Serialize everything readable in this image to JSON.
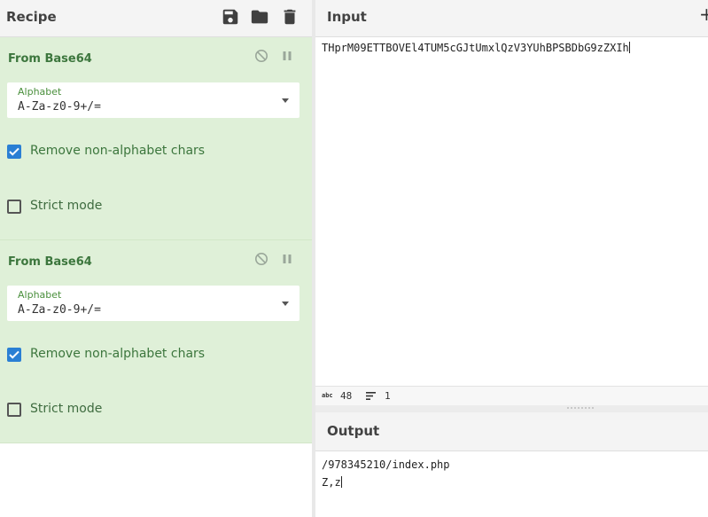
{
  "recipe": {
    "title": "Recipe",
    "icons": [
      "save-icon",
      "folder-icon",
      "trash-icon"
    ],
    "operations": [
      {
        "name": "From Base64",
        "alphabet_label": "Alphabet",
        "alphabet_value": "A-Za-z0-9+/=",
        "remove_non_alphabet_label": "Remove non-alphabet chars",
        "remove_non_alphabet_checked": true,
        "strict_mode_label": "Strict mode",
        "strict_mode_checked": false
      },
      {
        "name": "From Base64",
        "alphabet_label": "Alphabet",
        "alphabet_value": "A-Za-z0-9+/=",
        "remove_non_alphabet_label": "Remove non-alphabet chars",
        "remove_non_alphabet_checked": true,
        "strict_mode_label": "Strict mode",
        "strict_mode_checked": false
      }
    ]
  },
  "input": {
    "title": "Input",
    "add_label": "+",
    "text": "THprM09ETTBOVEl4TUM5cGJtUmxlQzV3YUhBPSBDbG9zZXIh",
    "length": "48",
    "lines": "1"
  },
  "output": {
    "title": "Output",
    "line1": "/978345210/index.php",
    "line2": "Z,z"
  },
  "colors": {
    "op_bg": "#dff0d8",
    "op_text": "#3c763d",
    "checkbox_on": "#2a7fd4"
  }
}
